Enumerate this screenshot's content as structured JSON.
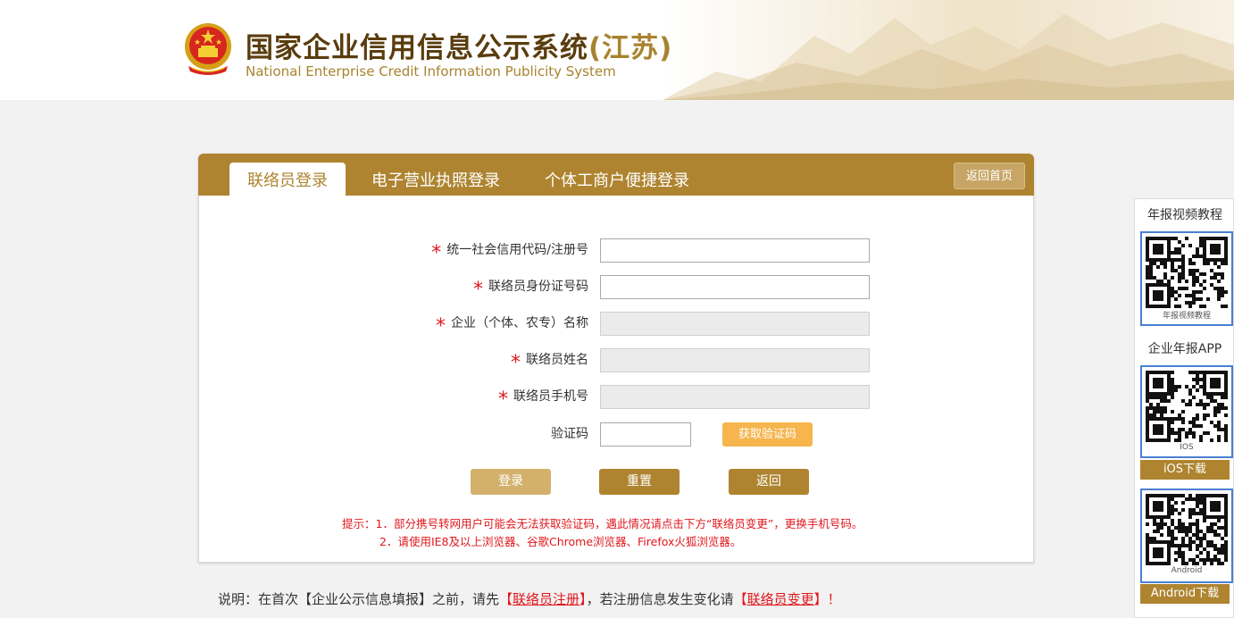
{
  "header": {
    "title": "国家企业信用信息公示系统",
    "province": "(江苏)",
    "subtitle": "National Enterprise Credit Information Publicity System"
  },
  "tabs": [
    {
      "label": "联络员登录",
      "active": true
    },
    {
      "label": "电子营业执照登录",
      "active": false
    },
    {
      "label": "个体工商户便捷登录",
      "active": false
    }
  ],
  "home_button": "返回首页",
  "form": {
    "fields": [
      {
        "label": "统一社会信用代码/注册号",
        "required": true,
        "value": "",
        "disabled": false
      },
      {
        "label": "联络员身份证号码",
        "required": true,
        "value": "",
        "disabled": false
      },
      {
        "label": "企业（个体、农专）名称",
        "required": true,
        "value": "",
        "disabled": true
      },
      {
        "label": "联络员姓名",
        "required": true,
        "value": "",
        "disabled": true
      },
      {
        "label": "联络员手机号",
        "required": true,
        "value": "",
        "disabled": true
      }
    ],
    "captcha_label": "验证码",
    "captcha_value": "",
    "sms_button": "获取验证码",
    "required_mark": "*"
  },
  "actions": {
    "login": "登录",
    "reset": "重置",
    "back": "返回"
  },
  "tips": {
    "line1": "提示：1．部分携号转网用户可能会无法获取验证码，遇此情况请点击下方“联络员变更”，更换手机号码。",
    "line2": "2．请使用IE8及以上浏览器、谷歌Chrome浏览器、Firefox火狐浏览器。"
  },
  "note": {
    "prefix": "说明：在首次【企业公示信息填报】之前，请先",
    "register_link": "联络员注册",
    "middle": "，若注册信息发生变化请",
    "change_link": "联络员变更",
    "suffix": "！",
    "bracket_open": "【",
    "bracket_close": "】"
  },
  "sidebar": {
    "video_title": "年报视频教程",
    "video_qr_caption": "年报视频教程",
    "app_title": "企业年报APP",
    "ios_qr_caption": "IOS",
    "ios_button": "iOS下载",
    "android_qr_caption": "Android",
    "android_button": "Android下载"
  },
  "colors": {
    "brand": "#ae8430",
    "brand_light": "#d3b16d",
    "accent_orange": "#f6b54d",
    "required_red": "#e0171d",
    "qr_border": "#4a7fd1"
  }
}
